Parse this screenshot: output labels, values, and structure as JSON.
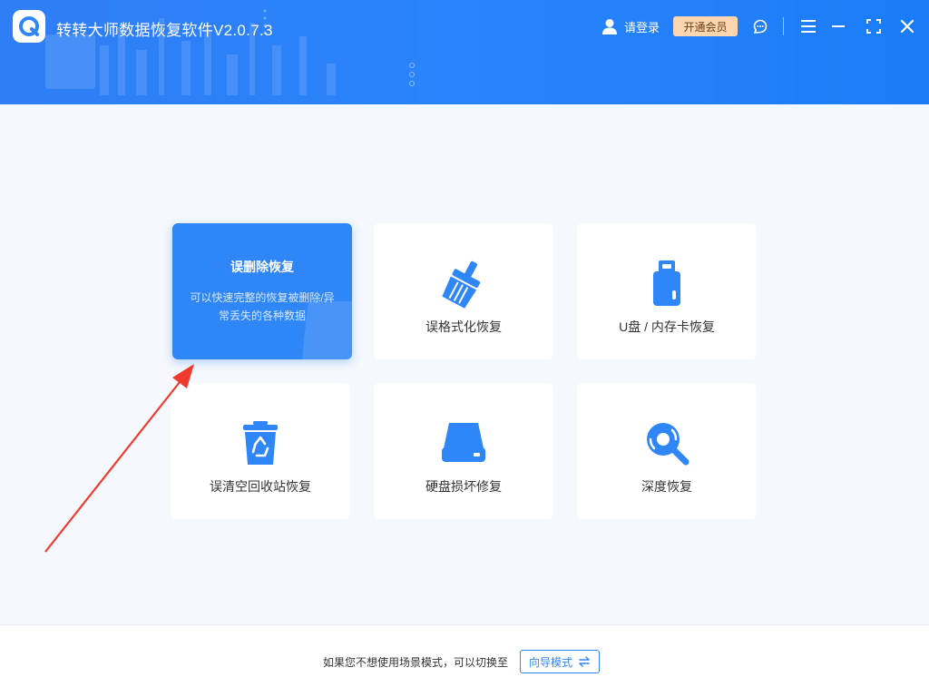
{
  "window": {
    "title": "转转大师数据恢复软件V2.0.7.3",
    "login_label": "请登录",
    "vip_label": "开通会员"
  },
  "cards": {
    "delete": {
      "title": "误删除恢复",
      "description": "可以快速完整的恢复被删除/异常丢失的各种数据"
    },
    "format": {
      "label": "误格式化恢复"
    },
    "usb": {
      "label": "U盘 / 内存卡恢复"
    },
    "recycle": {
      "label": "误清空回收站恢复"
    },
    "disk": {
      "label": "硬盘损坏修复"
    },
    "deep": {
      "label": "深度恢复"
    }
  },
  "footer": {
    "text": "如果您不想使用场景模式，可以切换至",
    "guide_label": "向导模式"
  },
  "colors": {
    "header_blue": "#2a84fb",
    "accent": "#2f86f6",
    "vip_bg": "#fbd6b0",
    "annotation_arrow": "#f03a2e"
  }
}
